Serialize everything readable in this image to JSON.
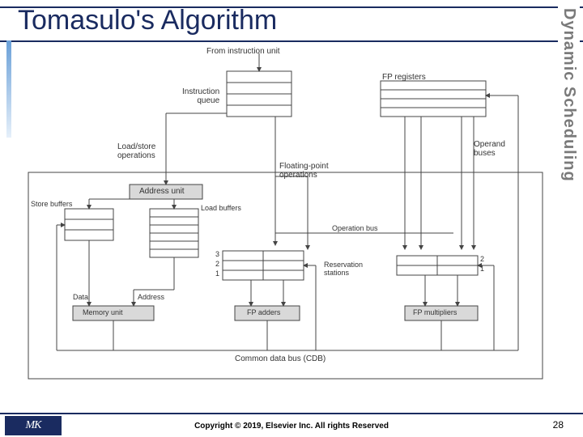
{
  "slide": {
    "title": "Tomasulo's Algorithm",
    "sidebar": "Dynamic Scheduling",
    "copyright": "Copyright © 2019, Elsevier Inc. All rights Reserved",
    "page_number": "28",
    "logo_text": "MK"
  },
  "diagram": {
    "from_instruction_unit": "From instruction unit",
    "instruction_queue": "Instruction\nqueue",
    "fp_registers": "FP registers",
    "load_store_operations": "Load/store\noperations",
    "floating_point_operations": "Floating-point\noperations",
    "operand_buses": "Operand\nbuses",
    "address_unit": "Address unit",
    "store_buffers": "Store buffers",
    "load_buffers": "Load buffers",
    "operation_bus": "Operation bus",
    "reservation_stations": "Reservation\nstations",
    "rs_left": {
      "r1": "1",
      "r2": "2",
      "r3": "3"
    },
    "rs_right": {
      "r1": "1",
      "r2": "2"
    },
    "data": "Data",
    "address": "Address",
    "memory_unit": "Memory unit",
    "fp_adders": "FP adders",
    "fp_multipliers": "FP multipliers",
    "cdb": "Common data bus (CDB)"
  }
}
